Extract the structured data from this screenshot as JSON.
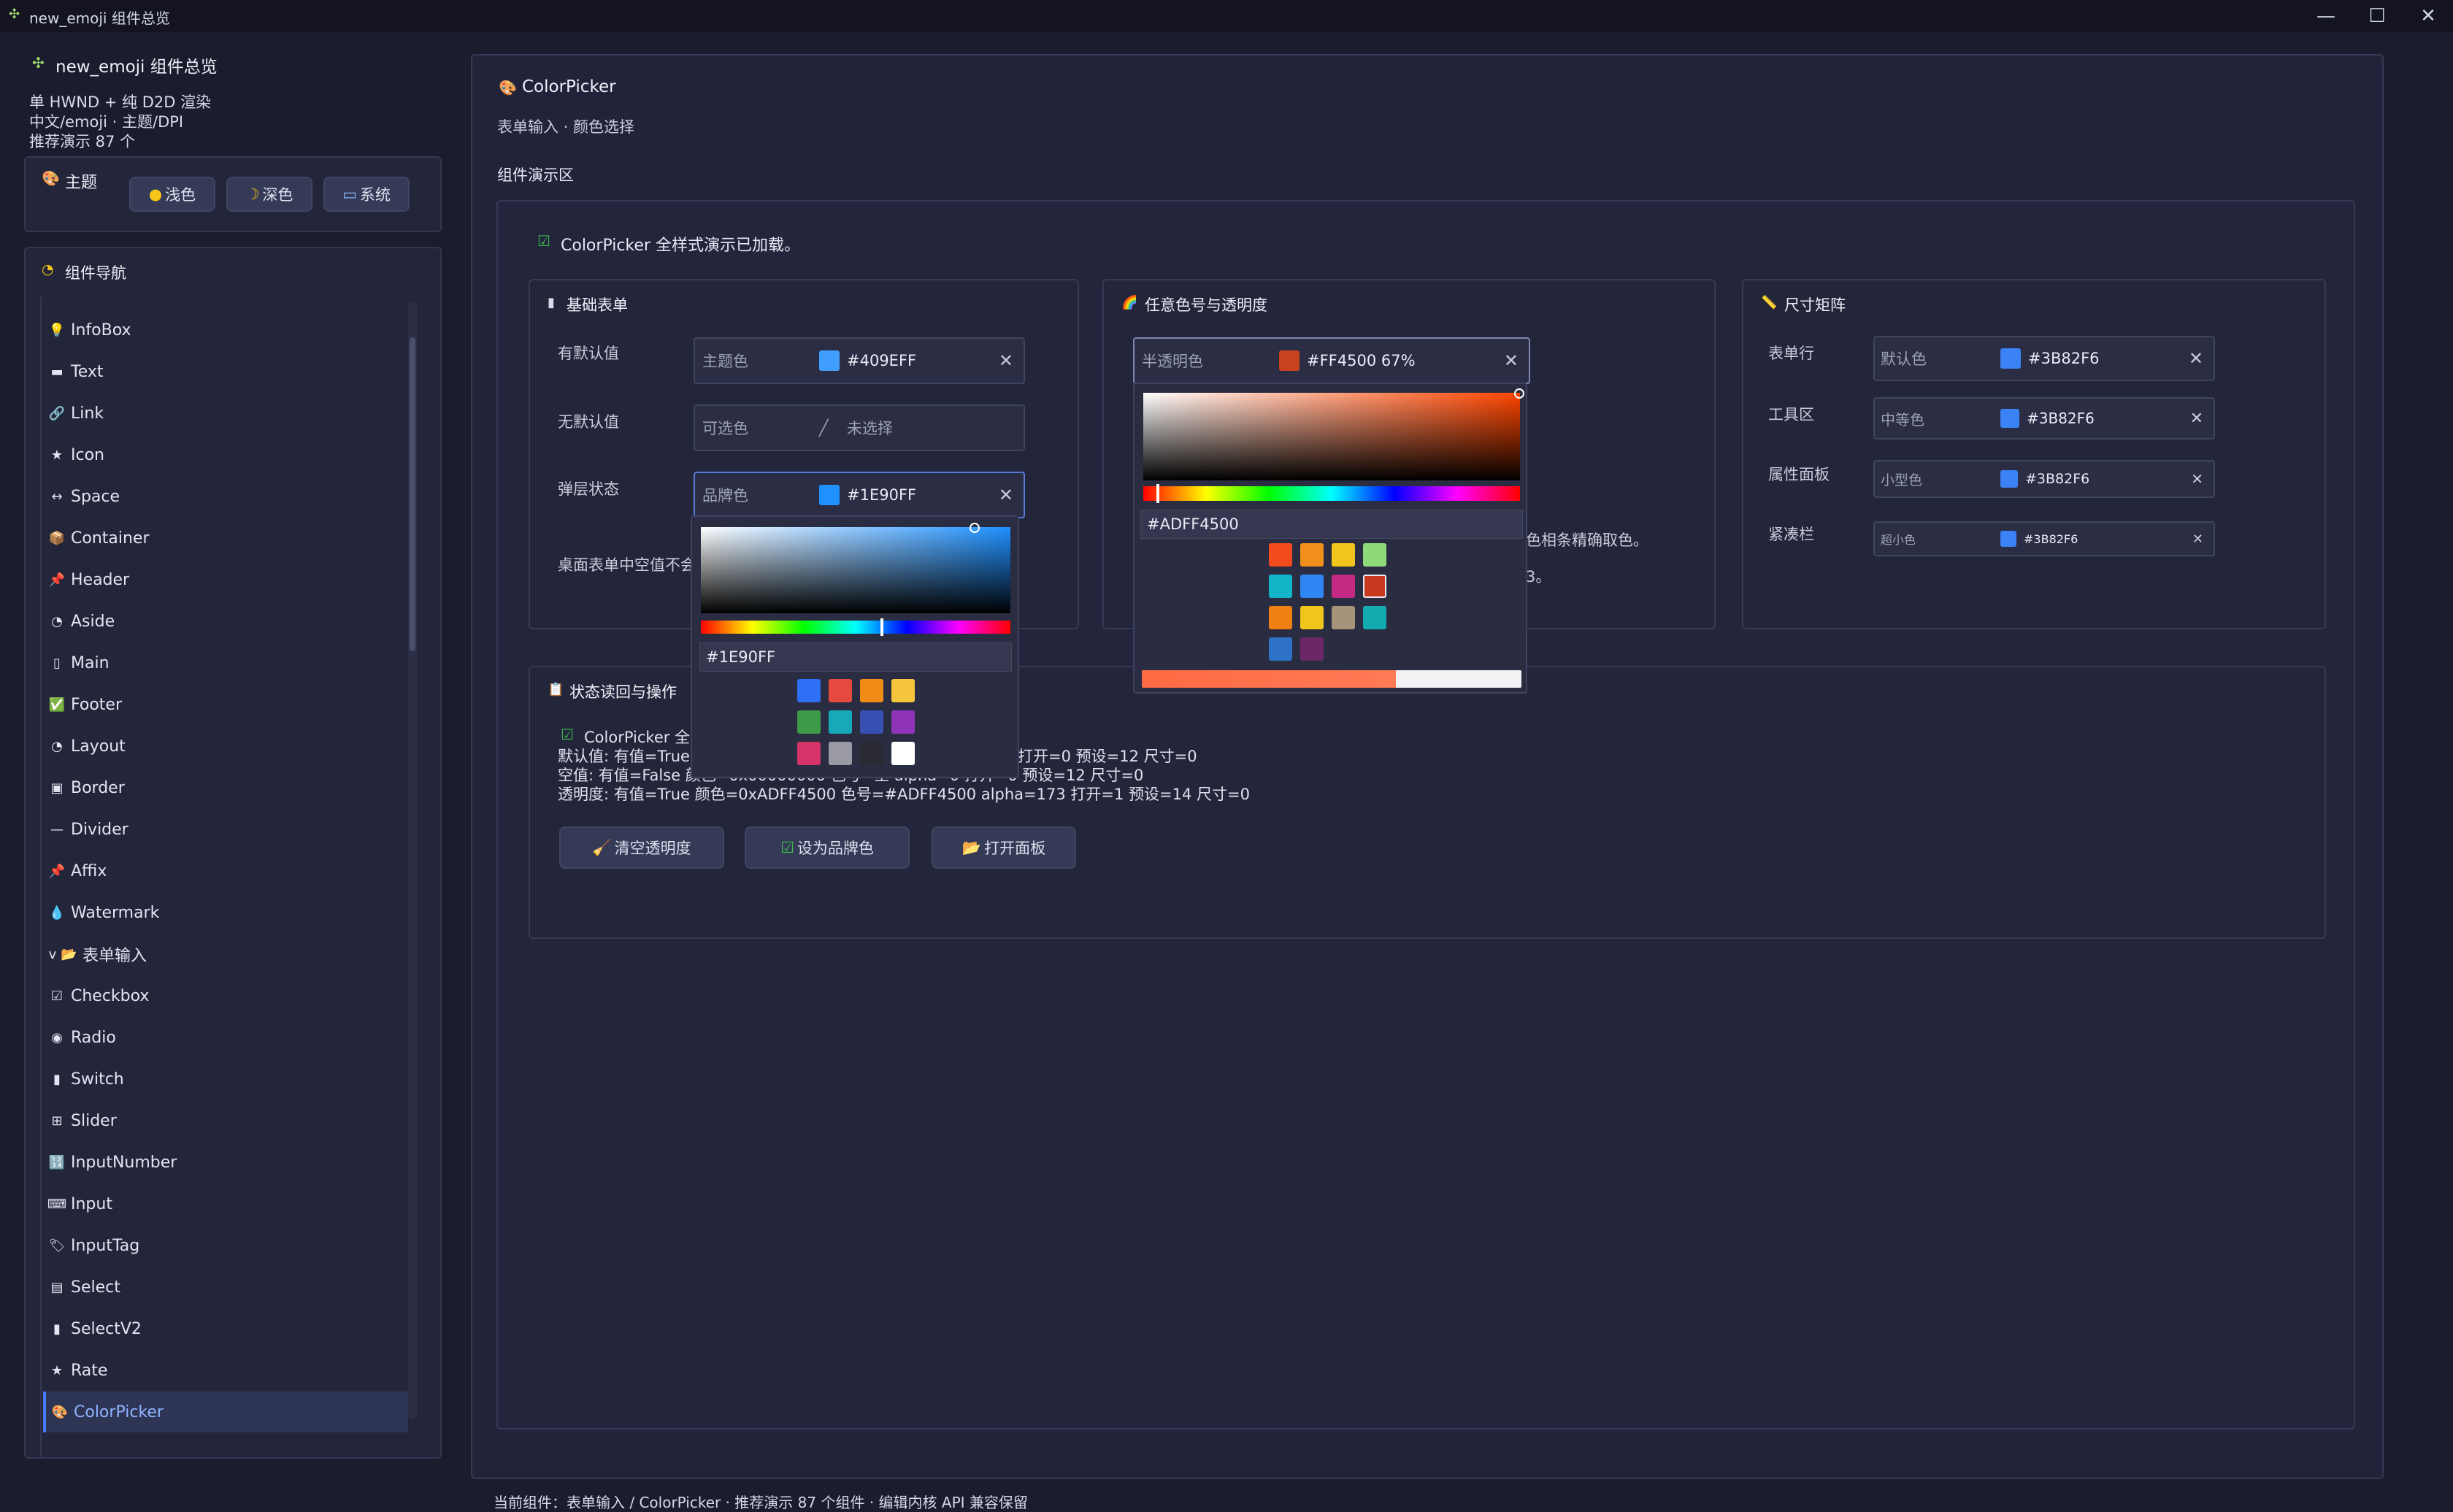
{
  "window": {
    "title": "new_emoji 组件总览",
    "min": "—",
    "max": "☐",
    "close": "✕"
  },
  "sidebar": {
    "app_title": "new_emoji 组件总览",
    "desc1": "单 HWND + 纯 D2D 渲染",
    "desc2": "中文/emoji · 主题/DPI",
    "desc3": "推荐演示 87 个",
    "theme": {
      "label": "主题",
      "light": "浅色",
      "dark": "深色",
      "system": "系统"
    },
    "nav_title": "组件导航",
    "items": [
      {
        "icon": "💡",
        "label": "InfoBox"
      },
      {
        "icon": "▬",
        "label": "Text"
      },
      {
        "icon": "🔗",
        "label": "Link"
      },
      {
        "icon": "★",
        "label": "Icon"
      },
      {
        "icon": "↔",
        "label": "Space"
      },
      {
        "icon": "📦",
        "label": "Container"
      },
      {
        "icon": "📌",
        "label": "Header"
      },
      {
        "icon": "◔",
        "label": "Aside"
      },
      {
        "icon": "▯",
        "label": "Main"
      },
      {
        "icon": "✅",
        "label": "Footer"
      },
      {
        "icon": "◔",
        "label": "Layout"
      },
      {
        "icon": "▣",
        "label": "Border"
      },
      {
        "icon": "—",
        "label": "Divider"
      },
      {
        "icon": "📌",
        "label": "Affix"
      },
      {
        "icon": "💧",
        "label": "Watermark"
      },
      {
        "icon": "v 📂",
        "label": "表单输入"
      },
      {
        "icon": "☑",
        "label": "Checkbox"
      },
      {
        "icon": "◉",
        "label": "Radio"
      },
      {
        "icon": "▮",
        "label": "Switch"
      },
      {
        "icon": "⊞",
        "label": "Slider"
      },
      {
        "icon": "🔢",
        "label": "InputNumber"
      },
      {
        "icon": "⌨",
        "label": "Input"
      },
      {
        "icon": "🏷",
        "label": "InputTag"
      },
      {
        "icon": "▤",
        "label": "Select"
      },
      {
        "icon": "▮",
        "label": "SelectV2"
      },
      {
        "icon": "★",
        "label": "Rate"
      },
      {
        "icon": "🎨",
        "label": "ColorPicker"
      }
    ]
  },
  "main": {
    "title": "ColorPicker",
    "subtitle": "表单输入 · 颜色选择",
    "demo_area": "组件演示区",
    "loaded_msg": "ColorPicker 全样式演示已加载。",
    "basic": {
      "title": "基础表单",
      "row1": {
        "label": "有默认值",
        "placeholder": "主题色",
        "value": "#409EFF",
        "color": "#409EFF"
      },
      "row2": {
        "label": "无默认值",
        "placeholder": "可选色",
        "value": "未选择"
      },
      "row3": {
        "label": "弹层状态",
        "placeholder": "品牌色",
        "value": "#1E90FF",
        "color": "#1E90FF"
      },
      "note": "桌面表单中空值不会"
    },
    "popup1": {
      "hex": "#1E90FF",
      "swatches": [
        "#2f6ff5",
        "#e44b3e",
        "#f08c16",
        "#f5c53b",
        "#3d9a48",
        "#18a9b8",
        "#3750b3",
        "#8f34b7",
        "#d63468",
        "#9a9aa4",
        "#2a2b32",
        "#ffffff"
      ]
    },
    "alpha": {
      "title": "任意色号与透明度",
      "placeholder": "半透明色",
      "value": "#FF4500 67%",
      "color": "#C9421E",
      "hidden_text1": "色相条精确取色。",
      "hidden_text2": "3。"
    },
    "popup2": {
      "hex": "#ADFF4500",
      "swatches": [
        "#f34b1d",
        "#f08f1a",
        "#f2c51d",
        "#8fd97a",
        "#11b5c8",
        "#2f86f2",
        "#c42a83",
        "#c8391f",
        "#f08012",
        "#f0c61a",
        "#a5937a",
        "#12aaaf",
        "#2e72c8",
        "#6b2766"
      ],
      "alpha_level": 0.67
    },
    "size": {
      "title": "尺寸矩阵",
      "rows": [
        {
          "label": "表单行",
          "placeholder": "默认色",
          "value": "#3B82F6"
        },
        {
          "label": "工具区",
          "placeholder": "中等色",
          "value": "#3B82F6"
        },
        {
          "label": "属性面板",
          "placeholder": "小型色",
          "value": "#3B82F6"
        },
        {
          "label": "紧凑栏",
          "placeholder": "超小色",
          "value": "#3B82F6"
        }
      ],
      "color": "#3B82F6"
    },
    "status": {
      "title": "状态读回与操作",
      "check_text": "ColorPicker 全",
      "line1a": "默认值: 有值=True",
      "line1b": "打开=0 预设=12 尺寸=0",
      "line2": "空值: 有值=False 颜色=0x00000000 色号=空 alpha=0 打开=0 预设=12 尺寸=0",
      "line3": "透明度: 有值=True 颜色=0xADFF4500 色号=#ADFF4500 alpha=173 打开=1 预设=14 尺寸=0",
      "btn_clear": "清空透明度",
      "btn_brand": "设为品牌色",
      "btn_open": "打开面板"
    },
    "footer": "当前组件：表单输入 / ColorPicker · 推荐演示 87 个组件 · 编辑内核 API 兼容保留"
  }
}
